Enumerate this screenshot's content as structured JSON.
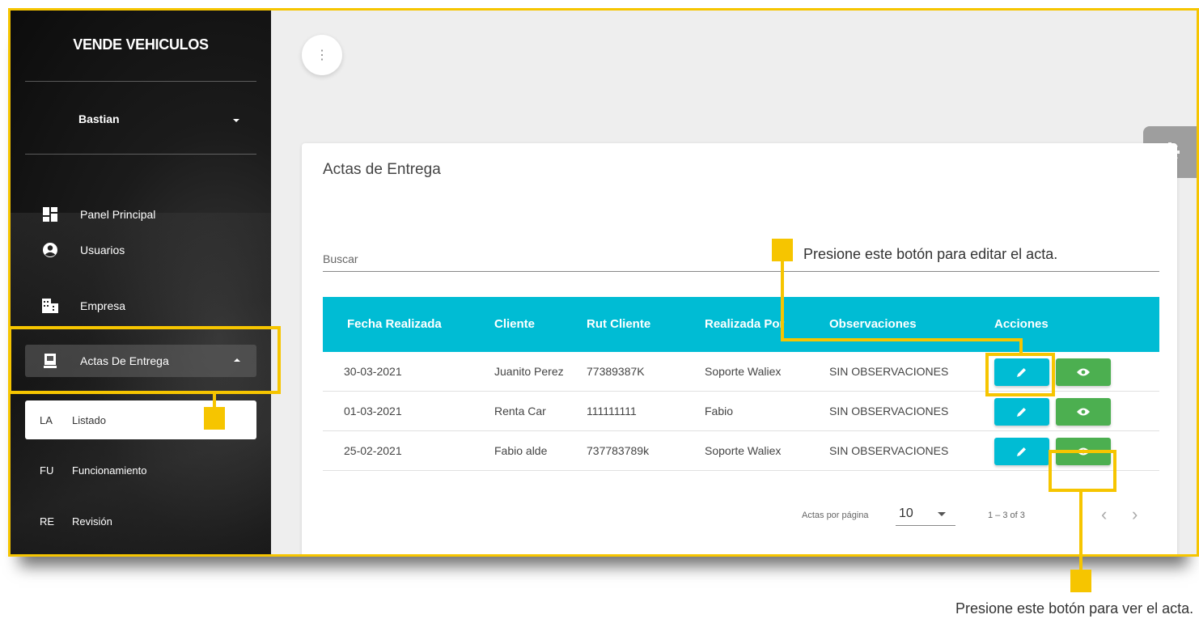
{
  "sidebar": {
    "brand": "VENDE VEHICULOS",
    "user": "Bastian",
    "items": [
      {
        "label": "Panel Principal",
        "icon": "dashboard-icon"
      },
      {
        "label": "Usuarios",
        "icon": "account-icon"
      },
      {
        "label": "Empresa",
        "icon": "building-icon"
      },
      {
        "label": "Actas De Entrega",
        "icon": "document-icon"
      }
    ],
    "subitems": [
      {
        "abbr": "LA",
        "label": "Listado"
      },
      {
        "abbr": "FU",
        "label": "Funcionamiento"
      },
      {
        "abbr": "RE",
        "label": "Revisión"
      }
    ]
  },
  "main": {
    "card_title": "Actas de Entrega",
    "search_placeholder": "Buscar",
    "columns": [
      "Fecha Realizada",
      "Cliente",
      "Rut Cliente",
      "Realizada Por",
      "Observaciones",
      "Acciones"
    ],
    "rows": [
      [
        "30-03-2021",
        "Juanito Perez",
        "77389387K",
        "Soporte Waliex",
        "SIN OBSERVACIONES"
      ],
      [
        "01-03-2021",
        "Renta Car",
        "111111111",
        "Fabio",
        "SIN OBSERVACIONES"
      ],
      [
        "25-02-2021",
        "Fabio alde",
        "737783789k",
        "Soporte Waliex",
        "SIN OBSERVACIONES"
      ]
    ],
    "pager": {
      "per_page_label": "Actas por página",
      "per_page_value": "10",
      "range": "1 – 3 of 3",
      "prev": "‹",
      "next": "›"
    }
  },
  "annotations": {
    "edit_note": "Presione este botón para editar el acta.",
    "view_note": "Presione este botón para ver el acta."
  },
  "colors": {
    "accent": "#f6c500",
    "table_header": "#00bcd4",
    "edit_button": "#00bcd4",
    "view_button": "#4caf50"
  }
}
